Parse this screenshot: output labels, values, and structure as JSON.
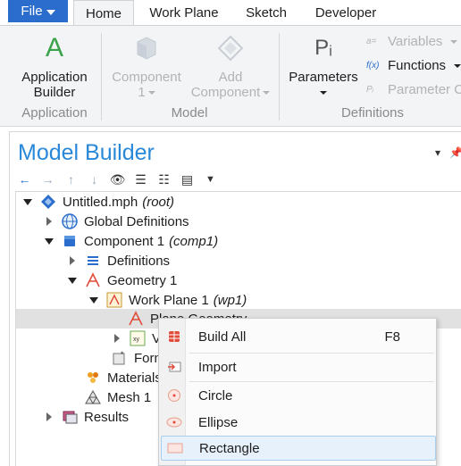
{
  "ribbon": {
    "file_label": "File",
    "tabs": [
      {
        "label": "Home",
        "active": true
      },
      {
        "label": "Work Plane",
        "active": false
      },
      {
        "label": "Sketch",
        "active": false
      },
      {
        "label": "Developer",
        "active": false
      }
    ],
    "application_builder": {
      "line1": "Application",
      "line2": "Builder",
      "icon_letter": "A"
    },
    "component": {
      "line1": "Component",
      "line2": "1"
    },
    "add_component": {
      "line1": "Add",
      "line2": "Component"
    },
    "parameters": {
      "label": "Parameters",
      "icon_text": "Pᵢ"
    },
    "variables": {
      "label": "Variables",
      "icon_text": "a="
    },
    "functions": {
      "label": "Functions",
      "icon_text": "f(x)"
    },
    "parameter_case": {
      "label": "Parameter Ca",
      "icon_text": "Pᵢ"
    },
    "groups": {
      "application": "Application",
      "model": "Model",
      "definitions": "Definitions"
    }
  },
  "model_builder": {
    "title": "Model Builder",
    "tree": [
      {
        "label": "Untitled.mph",
        "tag": "(root)"
      },
      {
        "label": "Global Definitions",
        "tag": ""
      },
      {
        "label": "Component 1",
        "tag": "(comp1)"
      },
      {
        "label": "Definitions",
        "tag": ""
      },
      {
        "label": "Geometry 1",
        "tag": ""
      },
      {
        "label": "Work Plane 1",
        "tag": "(wp1)"
      },
      {
        "label": "Plane Geometry",
        "tag": ""
      },
      {
        "label": "V",
        "tag": ""
      },
      {
        "label": "Form",
        "tag": ""
      },
      {
        "label": "Materials",
        "tag": ""
      },
      {
        "label": "Mesh 1",
        "tag": ""
      },
      {
        "label": "Results",
        "tag": ""
      }
    ]
  },
  "context_menu": {
    "items": [
      {
        "label": "Build All",
        "shortcut": "F8"
      },
      {
        "label": "Import",
        "shortcut": ""
      },
      {
        "label": "Circle",
        "shortcut": ""
      },
      {
        "label": "Ellipse",
        "shortcut": ""
      },
      {
        "label": "Rectangle",
        "shortcut": ""
      }
    ]
  },
  "colors": {
    "accent": "#2a6dcc",
    "title_blue": "#2a88d8",
    "geometry_red": "#e04b3a",
    "hover": "#e6f1fb"
  }
}
